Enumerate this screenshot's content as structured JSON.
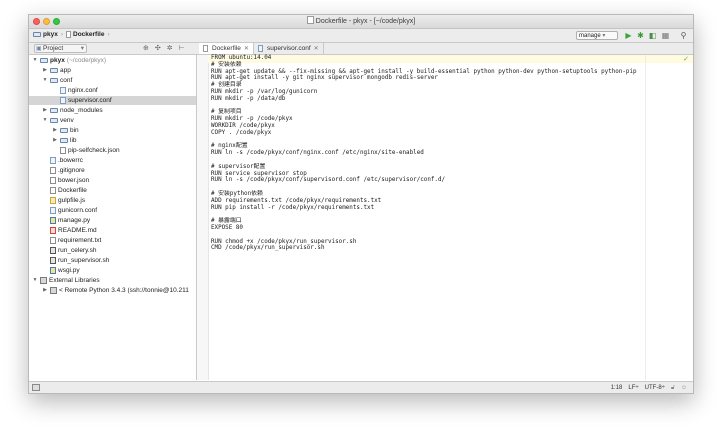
{
  "window": {
    "title": "Dockerfile - pkyx - [~/code/pkyx]"
  },
  "navbar": {
    "breadcrumb": [
      "pkyx",
      "Dockerfile"
    ],
    "run_config": "manage",
    "icons": [
      "run-icon",
      "debug-icon",
      "coverage-icon",
      "stop-icon",
      "search-icon"
    ]
  },
  "project_panel": {
    "selector_label": "Project",
    "tree": [
      {
        "depth": 0,
        "type": "folder",
        "label": "pkyx",
        "extra": "(~/code/pkyx)",
        "arrow": "down"
      },
      {
        "depth": 1,
        "type": "folder",
        "label": "app",
        "arrow": "right"
      },
      {
        "depth": 1,
        "type": "folder",
        "label": "conf",
        "arrow": "down"
      },
      {
        "depth": 2,
        "type": "cfg",
        "label": "nginx.conf"
      },
      {
        "depth": 2,
        "type": "cfg",
        "label": "supervisor.conf",
        "selected": true
      },
      {
        "depth": 1,
        "type": "folder",
        "label": "node_modules",
        "arrow": "right"
      },
      {
        "depth": 1,
        "type": "folder",
        "label": "venv",
        "arrow": "down"
      },
      {
        "depth": 2,
        "type": "folder",
        "label": "bin",
        "arrow": "right"
      },
      {
        "depth": 2,
        "type": "folder",
        "label": "lib",
        "arrow": "right"
      },
      {
        "depth": 2,
        "type": "file",
        "label": "pip-selfcheck.json"
      },
      {
        "depth": 1,
        "type": "cfg",
        "label": ".bowerrc"
      },
      {
        "depth": 1,
        "type": "file",
        "label": ".gitignore"
      },
      {
        "depth": 1,
        "type": "file",
        "label": "bower.json"
      },
      {
        "depth": 1,
        "type": "file",
        "label": "Dockerfile"
      },
      {
        "depth": 1,
        "type": "js",
        "label": "gulpfile.js"
      },
      {
        "depth": 1,
        "type": "cfg",
        "label": "gunicorn.conf"
      },
      {
        "depth": 1,
        "type": "py",
        "label": "manage.py"
      },
      {
        "depth": 1,
        "type": "red",
        "label": "README.md"
      },
      {
        "depth": 1,
        "type": "file",
        "label": "requirement.txt"
      },
      {
        "depth": 1,
        "type": "sh",
        "label": "run_celery.sh"
      },
      {
        "depth": 1,
        "type": "sh",
        "label": "run_supervisor.sh"
      },
      {
        "depth": 1,
        "type": "py",
        "label": "wsgi.py"
      },
      {
        "depth": 0,
        "type": "lib",
        "label": "External Libraries",
        "arrow": "down"
      },
      {
        "depth": 1,
        "type": "lib",
        "label": "< Remote Python 3.4.3 (ssh://tonnie@10.211",
        "arrow": "right"
      }
    ]
  },
  "tabs": [
    {
      "label": "Dockerfile",
      "active": true
    },
    {
      "label": "supervisor.conf",
      "active": false
    }
  ],
  "editor": {
    "lines": [
      "FROM ubuntu:14.04",
      "# 安装依赖",
      "RUN apt-get update && --fix-missing && apt-get install -y build-essential python python-dev python-setuptools python-pip",
      "RUN apt-get install -y git nginx supervisor mongodb redis-server",
      "# 创建目录",
      "RUN mkdir -p /var/log/gunicorn",
      "RUN mkdir -p /data/db",
      "",
      "# 复制项目",
      "RUN mkdir -p /code/pkyx",
      "WORKDIR /code/pkyx",
      "COPY . /code/pkyx",
      "",
      "# nginx配置",
      "RUN ln -s /code/pkyx/conf/nginx.conf /etc/nginx/site-enabled",
      "",
      "# supervisor配置",
      "RUN service supervisor stop",
      "RUN ln -s /code/pkyx/conf/supervisord.conf /etc/supervisor/conf.d/",
      "",
      "# 安装python依赖",
      "ADD requirements.txt /code/pkyx/requirements.txt",
      "RUN pip install -r /code/pkyx/requirements.txt",
      "",
      "# 暴露端口",
      "EXPOSE 80",
      "",
      "RUN chmod +x /code/pkyx/run_supervisor.sh",
      "CMD /code/pkyx/run_supervisor.sh"
    ]
  },
  "statusbar": {
    "position": "1:18",
    "line_sep": "LF÷",
    "encoding": "UTF-8÷"
  }
}
